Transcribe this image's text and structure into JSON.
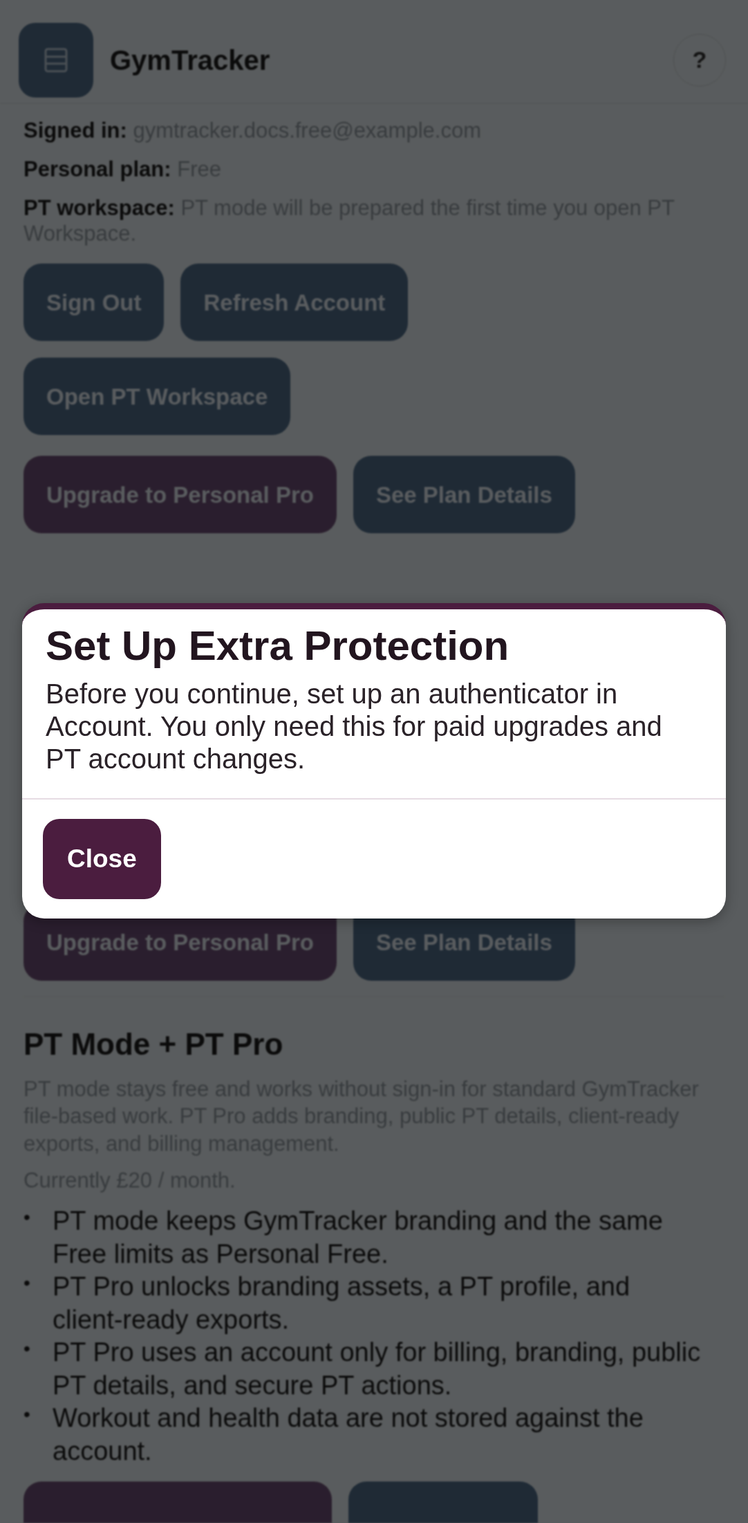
{
  "header": {
    "title": "GymTracker",
    "help": "?"
  },
  "account_lines": [
    {
      "label": "Signed in:",
      "value": "gymtracker.docs.free@example.com"
    },
    {
      "label": "Personal plan:",
      "value": "Free"
    },
    {
      "label": "PT workspace:",
      "value": "PT mode will be prepared the first time you open PT Workspace."
    }
  ],
  "button_rows": [
    [
      {
        "label": "Sign Out",
        "kind": "dark"
      },
      {
        "label": "Refresh Account",
        "kind": "dark"
      }
    ],
    [
      {
        "label": "Open PT Workspace",
        "kind": "dark"
      }
    ],
    [
      {
        "label": "Upgrade to Personal Pro",
        "kind": "primary"
      },
      {
        "label": "See Plan Details",
        "kind": "dark"
      }
    ]
  ],
  "covered_button_row": [
    {
      "label": "Upgrade to Personal Pro",
      "kind": "primary"
    },
    {
      "label": "See Plan Details",
      "kind": "dark"
    }
  ],
  "pt_section": {
    "heading": "PT Mode + PT Pro",
    "intro": "PT mode stays free and works without sign-in for standard GymTracker file-based work. PT Pro adds branding, public PT details, client-ready exports, and billing management.",
    "price": "Currently £20 / month.",
    "bullets": [
      {
        "marker": "•",
        "text": "PT mode keeps GymTracker branding and the same Free limits as Personal Free."
      },
      {
        "marker": "•",
        "text": "PT Pro unlocks branding assets, a PT profile, and client-ready exports."
      },
      {
        "marker": "•",
        "text": "PT Pro uses an account only for billing, branding, public PT details, and secure PT actions."
      },
      {
        "marker": "•",
        "text": "Workout and health data are not stored against the account."
      }
    ],
    "cut_off_buttons": [
      {
        "kind": "primary"
      },
      {
        "kind": "dark"
      }
    ]
  },
  "modal": {
    "title": "Set Up Extra Protection",
    "message": "Before you continue, set up an authenticator in Account. You only need this for paid upgrades and PT account changes.",
    "buttons": [
      "Close"
    ]
  }
}
